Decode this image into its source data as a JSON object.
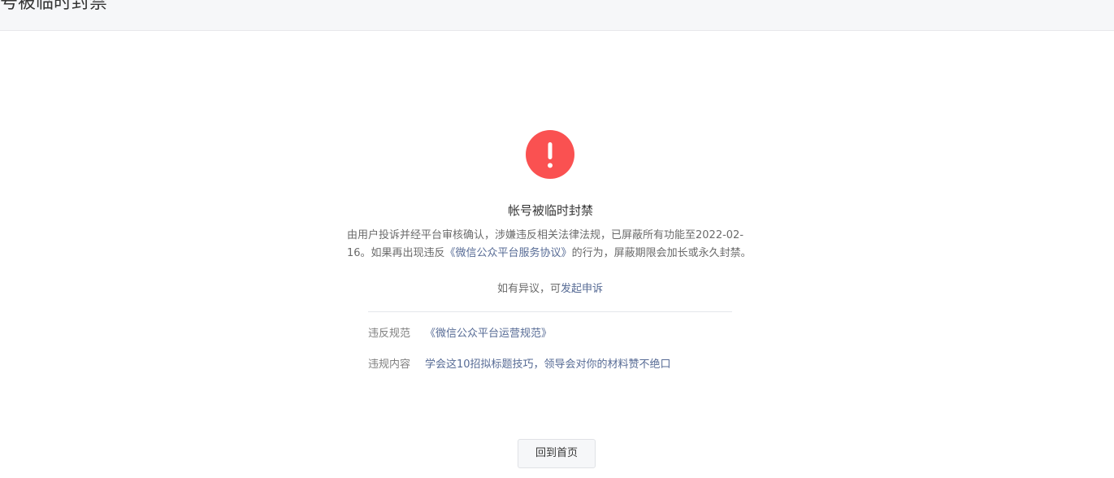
{
  "header": {
    "title": "帐号被临时封禁"
  },
  "notice": {
    "icon": "exclamation-circle-icon",
    "icon_color": "#fa5151",
    "title": "帐号被临时封禁",
    "desc_part1": "由用户投诉并经平台审核确认，涉嫌违反相关法律法规，已屏蔽所有功能至2022-02-16。如果再出现违反",
    "desc_link": "《微信公众平台服务协议》",
    "desc_part2": "的行为，屏蔽期限会加长或永久封禁。",
    "appeal_prefix": "如有异议，可",
    "appeal_link": "发起申诉"
  },
  "details": [
    {
      "label": "违反规范",
      "value": "《微信公众平台运营规范》"
    },
    {
      "label": "违规内容",
      "value": "学会这10招拟标题技巧，领导会对你的材料赞不绝口"
    }
  ],
  "actions": {
    "home_label": "回到首页"
  },
  "colors": {
    "link": "#576b95",
    "danger": "#fa5151"
  }
}
